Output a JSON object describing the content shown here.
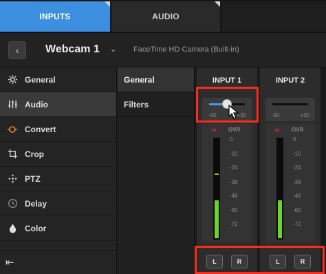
{
  "tabs": [
    {
      "label": "INPUTS",
      "active": true
    },
    {
      "label": "AUDIO",
      "active": false
    }
  ],
  "header": {
    "source_name": "Webcam 1",
    "device": "FaceTime HD Camera (Built-in)"
  },
  "sidebar": {
    "items": [
      {
        "label": "General",
        "icon": "gear-icon"
      },
      {
        "label": "Audio",
        "icon": "audio-mixer-icon",
        "active": true
      },
      {
        "label": "Convert",
        "icon": "convert-icon"
      },
      {
        "label": "Crop",
        "icon": "crop-icon"
      },
      {
        "label": "PTZ",
        "icon": "ptz-icon"
      },
      {
        "label": "Delay",
        "icon": "clock-icon"
      },
      {
        "label": "Color",
        "icon": "color-drop-icon"
      }
    ]
  },
  "subnav": {
    "items": [
      {
        "label": "General",
        "active": true
      },
      {
        "label": "Filters",
        "active": false
      }
    ]
  },
  "channels": [
    {
      "title": "INPUT 1",
      "gain": {
        "min_label": "-90",
        "max_label": "+30",
        "level_fraction": 0.5
      },
      "ovr_label": "OVR",
      "meter_level_fraction": 0.38,
      "meter_peak_fraction": 0.64,
      "scale": [
        "0",
        "-10",
        "-24",
        "-36",
        "-48",
        "-60",
        "-72"
      ],
      "buttons": [
        {
          "label": "L",
          "active": true
        },
        {
          "label": "R",
          "active": false
        }
      ]
    },
    {
      "title": "INPUT 2",
      "gain": {
        "min_label": "-90",
        "max_label": "+30",
        "level_fraction": 0.0
      },
      "ovr_label": "OVR",
      "meter_level_fraction": 0.38,
      "meter_peak_fraction": 0.0,
      "scale": [
        "0",
        "-10",
        "-24",
        "-36",
        "-48",
        "-60",
        "-72"
      ],
      "buttons": [
        {
          "label": "L",
          "active": false
        },
        {
          "label": "R",
          "active": true
        }
      ]
    }
  ],
  "colors": {
    "accent": "#3d8fe0",
    "meter": "#69d52a",
    "highlight": "#ff2a1a"
  }
}
